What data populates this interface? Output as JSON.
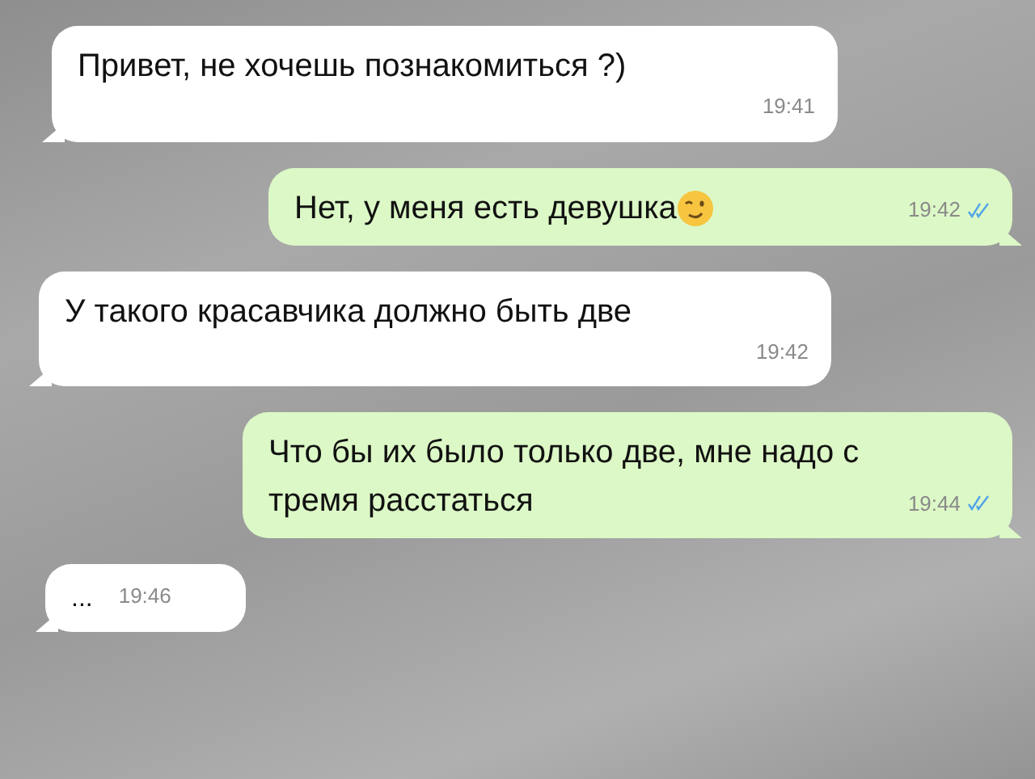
{
  "messages": [
    {
      "kind": "incoming",
      "text": "Привет, не хочешь познакомиться ?)",
      "time": "19:41",
      "emoji": false,
      "time_below": true
    },
    {
      "kind": "outgoing",
      "text": "Нет, у меня есть девушка",
      "time": "19:42",
      "emoji": true,
      "read": true,
      "time_below": false
    },
    {
      "kind": "incoming",
      "text": "У такого красавчика должно быть две",
      "time": "19:42",
      "emoji": false,
      "time_below": true
    },
    {
      "kind": "outgoing",
      "text": "Что бы их было только две, мне надо с тремя расстаться",
      "time": "19:44",
      "emoji": false,
      "read": true,
      "time_below": false
    },
    {
      "kind": "incoming",
      "text": "...",
      "time": "19:46",
      "emoji": false,
      "time_below": false
    }
  ]
}
